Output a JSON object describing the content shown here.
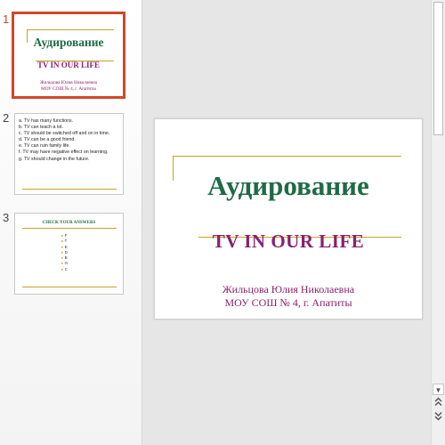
{
  "thumbnails": [
    {
      "number": "1",
      "title": "Аудирование",
      "subtitle": "TV IN OUR LIFE",
      "author_line1": "Жильцова Юлия Николаевна",
      "author_line2": "МОУ СОШ № 4, г. Апатиты"
    },
    {
      "number": "2",
      "items": [
        "a. TV has many functions.",
        "b. TV can teach a lot.",
        "c. TV should be switched off and on in time.",
        "d. TV can be a good friend.",
        "e. TV can ruin family life.",
        "f. TV may have negative effect on learning.",
        "g. TV should change in the future."
      ]
    },
    {
      "number": "3",
      "title": "CHECK YOUR ANSWERS",
      "answers": [
        "F",
        "T",
        "E",
        "D",
        "B",
        "G",
        "C"
      ]
    }
  ],
  "slide": {
    "title": "Аудирование",
    "subtitle": "TV IN OUR LIFE",
    "author_line1": "Жильцова Юлия Николаевна",
    "author_line2": "МОУ СОШ № 4, г. Апатиты"
  },
  "colors": {
    "accent_selected": "#d24726",
    "title_green": "#1f6b45",
    "subtitle_purple": "#8a1f6e",
    "rule_gold": "#c9a227"
  },
  "icons": {
    "scroll_up": "triangle-up-icon",
    "scroll_down": "triangle-down-icon",
    "prev_slide": "double-chevron-up-icon",
    "next_slide": "double-chevron-down-icon"
  }
}
